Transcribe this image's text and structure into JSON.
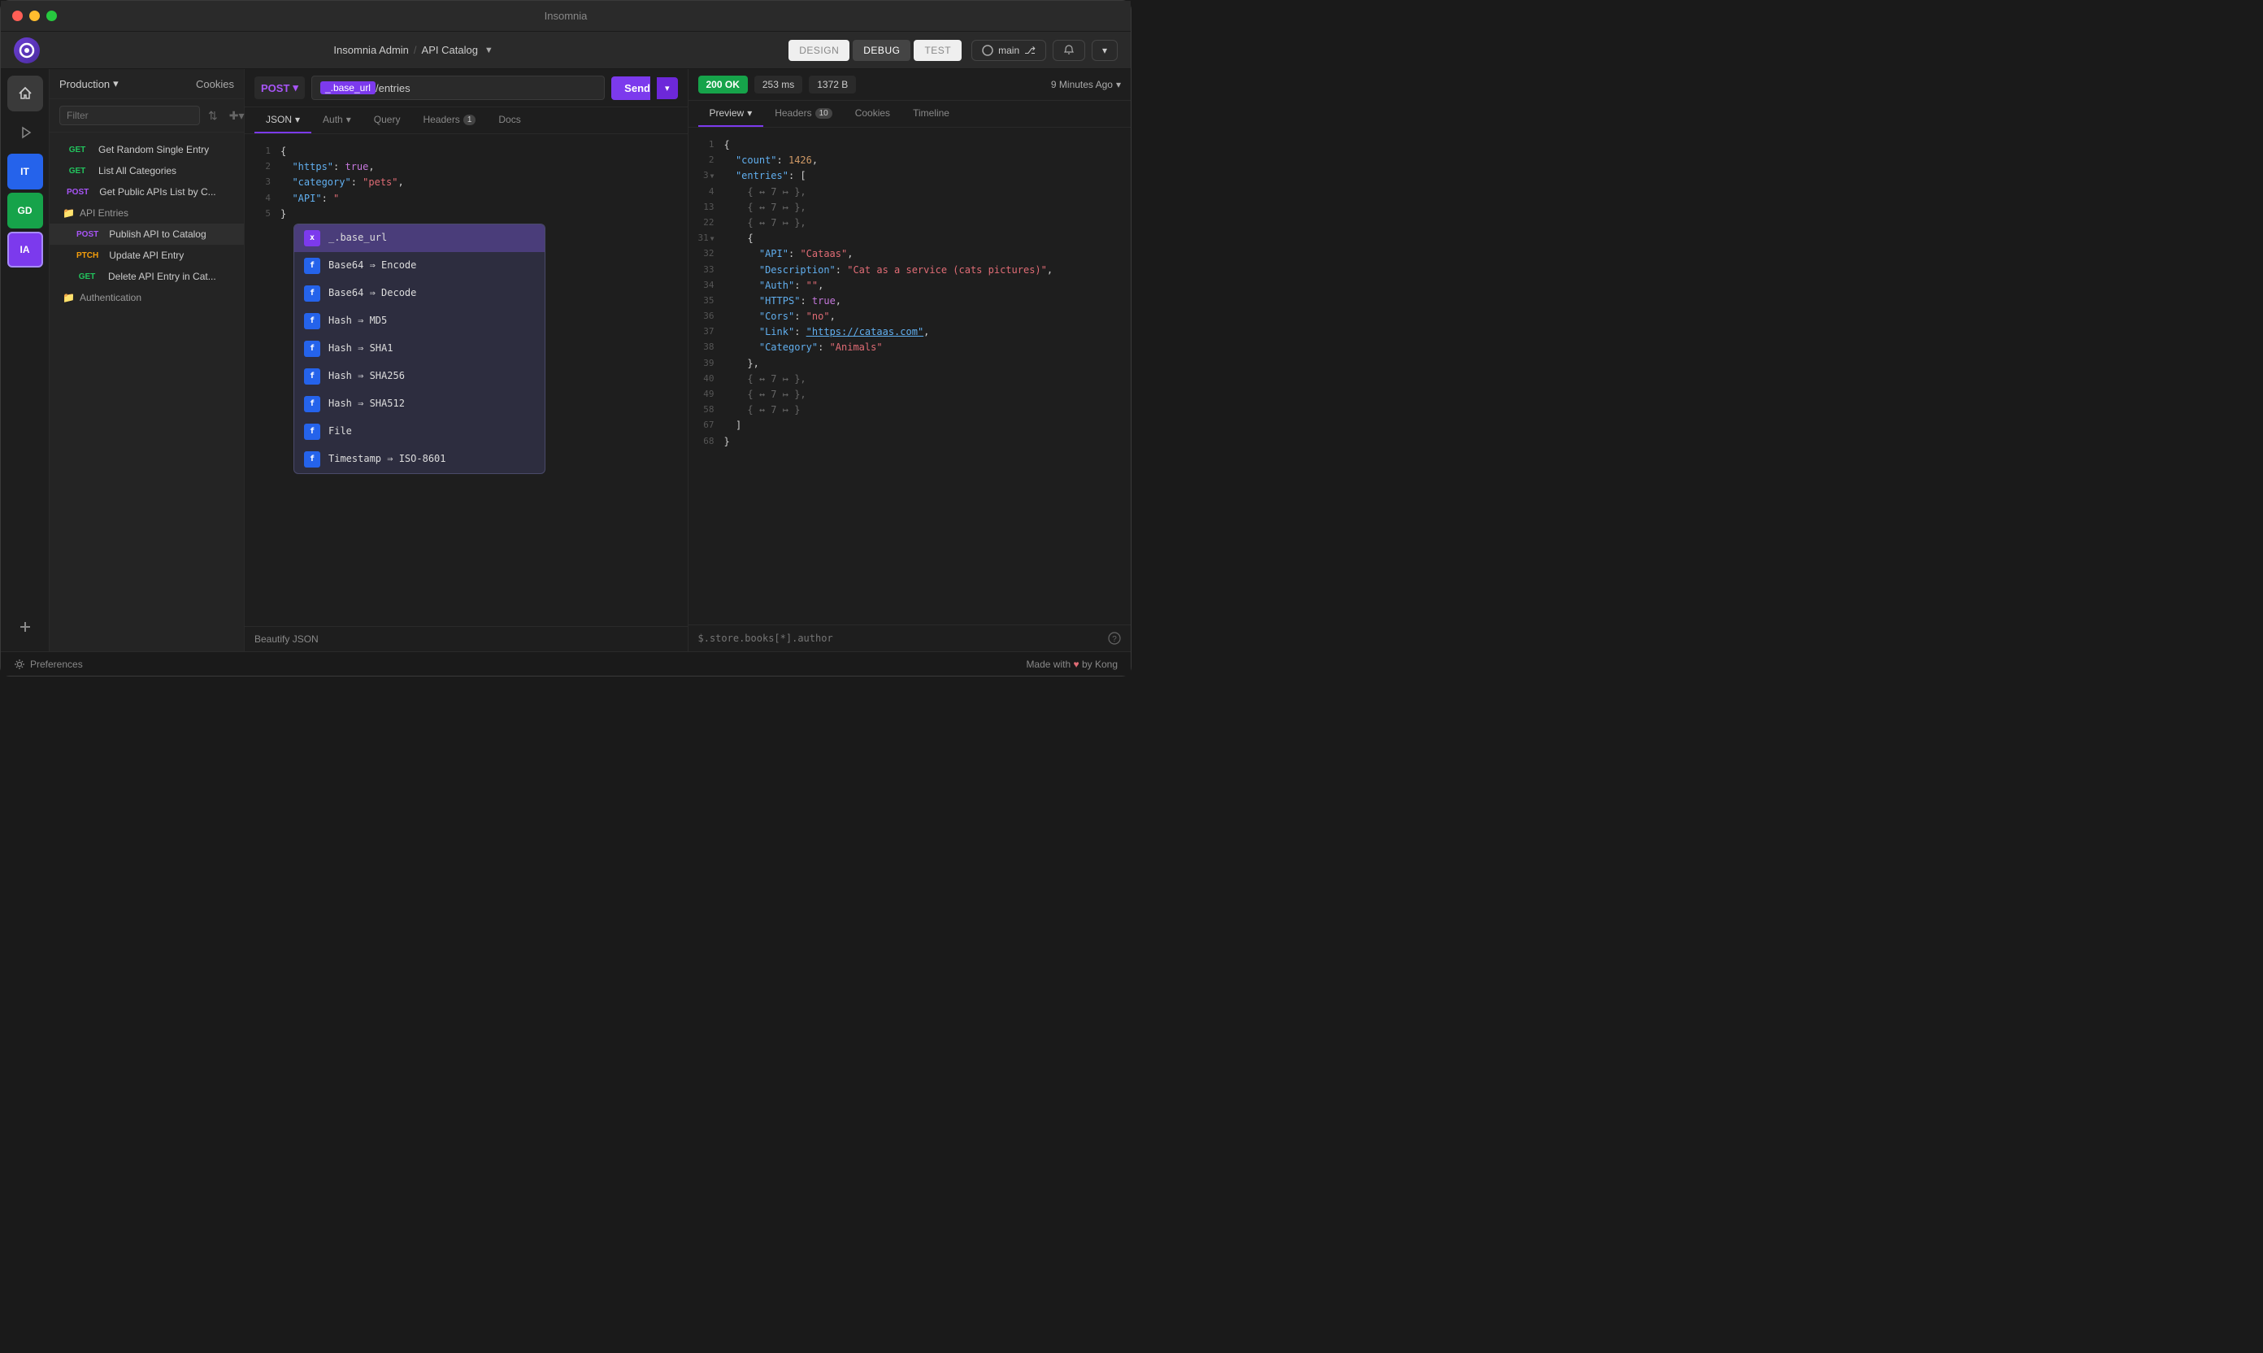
{
  "window": {
    "title": "Insomnia"
  },
  "titlebar": {
    "title": "Insomnia"
  },
  "toolbar": {
    "breadcrumb_workspace": "Insomnia Admin",
    "breadcrumb_sep": "/",
    "breadcrumb_project": "API Catalog",
    "tab_design": "DESIGN",
    "tab_debug": "DEBUG",
    "tab_test": "TEST",
    "branch_btn": "main",
    "branch_icon": "⎇"
  },
  "nav": {
    "env_label": "Production",
    "cookies_label": "Cookies",
    "filter_placeholder": "Filter",
    "items": [
      {
        "method": "GET",
        "label": "Get Random Single Entry",
        "type": "get"
      },
      {
        "method": "GET",
        "label": "List All Categories",
        "type": "get"
      },
      {
        "method": "POST",
        "label": "Get Public APIs List by C...",
        "type": "post"
      }
    ],
    "folder_api_entries": "API Entries",
    "folder_api_entries_items": [
      {
        "method": "POST",
        "label": "Publish API to Catalog",
        "type": "post"
      },
      {
        "method": "PTCH",
        "label": "Update API Entry",
        "type": "patch"
      },
      {
        "method": "GET",
        "label": "Delete API Entry in Cat...",
        "type": "get"
      }
    ],
    "folder_auth": "Authentication"
  },
  "request": {
    "method": "POST",
    "url_tag": "_.base_url",
    "url_path": "/entries",
    "send_label": "Send",
    "tabs": [
      {
        "label": "JSON",
        "active": true
      },
      {
        "label": "Auth"
      },
      {
        "label": "Query"
      },
      {
        "label": "Headers",
        "badge": "1"
      },
      {
        "label": "Docs"
      }
    ],
    "body_lines": [
      {
        "num": "1",
        "content": "{"
      },
      {
        "num": "2",
        "content": "  \"https\": true,"
      },
      {
        "num": "3",
        "content": "  \"category\": \"pets\","
      },
      {
        "num": "4",
        "content": "  \"API\": \"\""
      },
      {
        "num": "5",
        "content": "}"
      }
    ],
    "beautify_label": "Beautify JSON",
    "autocomplete": [
      {
        "type": "x",
        "label": "_.base_url"
      },
      {
        "type": "f",
        "label": "Base64 ⇒ Encode"
      },
      {
        "type": "f",
        "label": "Base64 ⇒ Decode"
      },
      {
        "type": "f",
        "label": "Hash ⇒ MD5"
      },
      {
        "type": "f",
        "label": "Hash ⇒ SHA1"
      },
      {
        "type": "f",
        "label": "Hash ⇒ SHA256"
      },
      {
        "type": "f",
        "label": "Hash ⇒ SHA512"
      },
      {
        "type": "f",
        "label": "File"
      },
      {
        "type": "f",
        "label": "Timestamp ⇒ ISO-8601"
      }
    ]
  },
  "response": {
    "status": "200 OK",
    "time": "253 ms",
    "size": "1372 B",
    "time_ago": "9 Minutes Ago",
    "tabs": [
      {
        "label": "Preview",
        "active": true
      },
      {
        "label": "Headers",
        "badge": "10"
      },
      {
        "label": "Cookies"
      },
      {
        "label": "Timeline"
      }
    ],
    "jsonpath_placeholder": "$.store.books[*].author",
    "body": [
      {
        "num": "1",
        "content": "{"
      },
      {
        "num": "2",
        "content": "  \"count\": 1426,"
      },
      {
        "num": "3",
        "content": "  \"entries\": [",
        "expand": true
      },
      {
        "num": "4",
        "content": "    { ↔ 7 ↦ },",
        "collapsed": true
      },
      {
        "num": "13",
        "content": "    { ↔ 7 ↦ },",
        "collapsed": true
      },
      {
        "num": "22",
        "content": "    { ↔ 7 ↦ },",
        "collapsed": true
      },
      {
        "num": "31",
        "content": "    {",
        "expand": true
      },
      {
        "num": "32",
        "content": "      \"API\": \"Cataas\","
      },
      {
        "num": "33",
        "content": "      \"Description\": \"Cat as a service (cats pictures)\","
      },
      {
        "num": "34",
        "content": "      \"Auth\": \"\","
      },
      {
        "num": "35",
        "content": "      \"HTTPS\": true,"
      },
      {
        "num": "36",
        "content": "      \"Cors\": \"no\","
      },
      {
        "num": "37",
        "content": "      \"Link\": \"https://cataas.com\","
      },
      {
        "num": "38",
        "content": "      \"Category\": \"Animals\""
      },
      {
        "num": "39",
        "content": "    },"
      },
      {
        "num": "40",
        "content": "    { ↔ 7 ↦ },",
        "collapsed": true
      },
      {
        "num": "49",
        "content": "    { ↔ 7 ↦ },",
        "collapsed": true
      },
      {
        "num": "58",
        "content": "    { ↔ 7 ↦ }",
        "collapsed": true
      },
      {
        "num": "67",
        "content": "  ]"
      },
      {
        "num": "68",
        "content": "}"
      }
    ]
  },
  "statusbar": {
    "prefs_label": "Preferences",
    "made_with": "Made with",
    "by_label": "by Kong"
  },
  "colors": {
    "accent": "#7c3aed",
    "get": "#22c55e",
    "post": "#a855f7",
    "patch": "#f59e0b"
  }
}
